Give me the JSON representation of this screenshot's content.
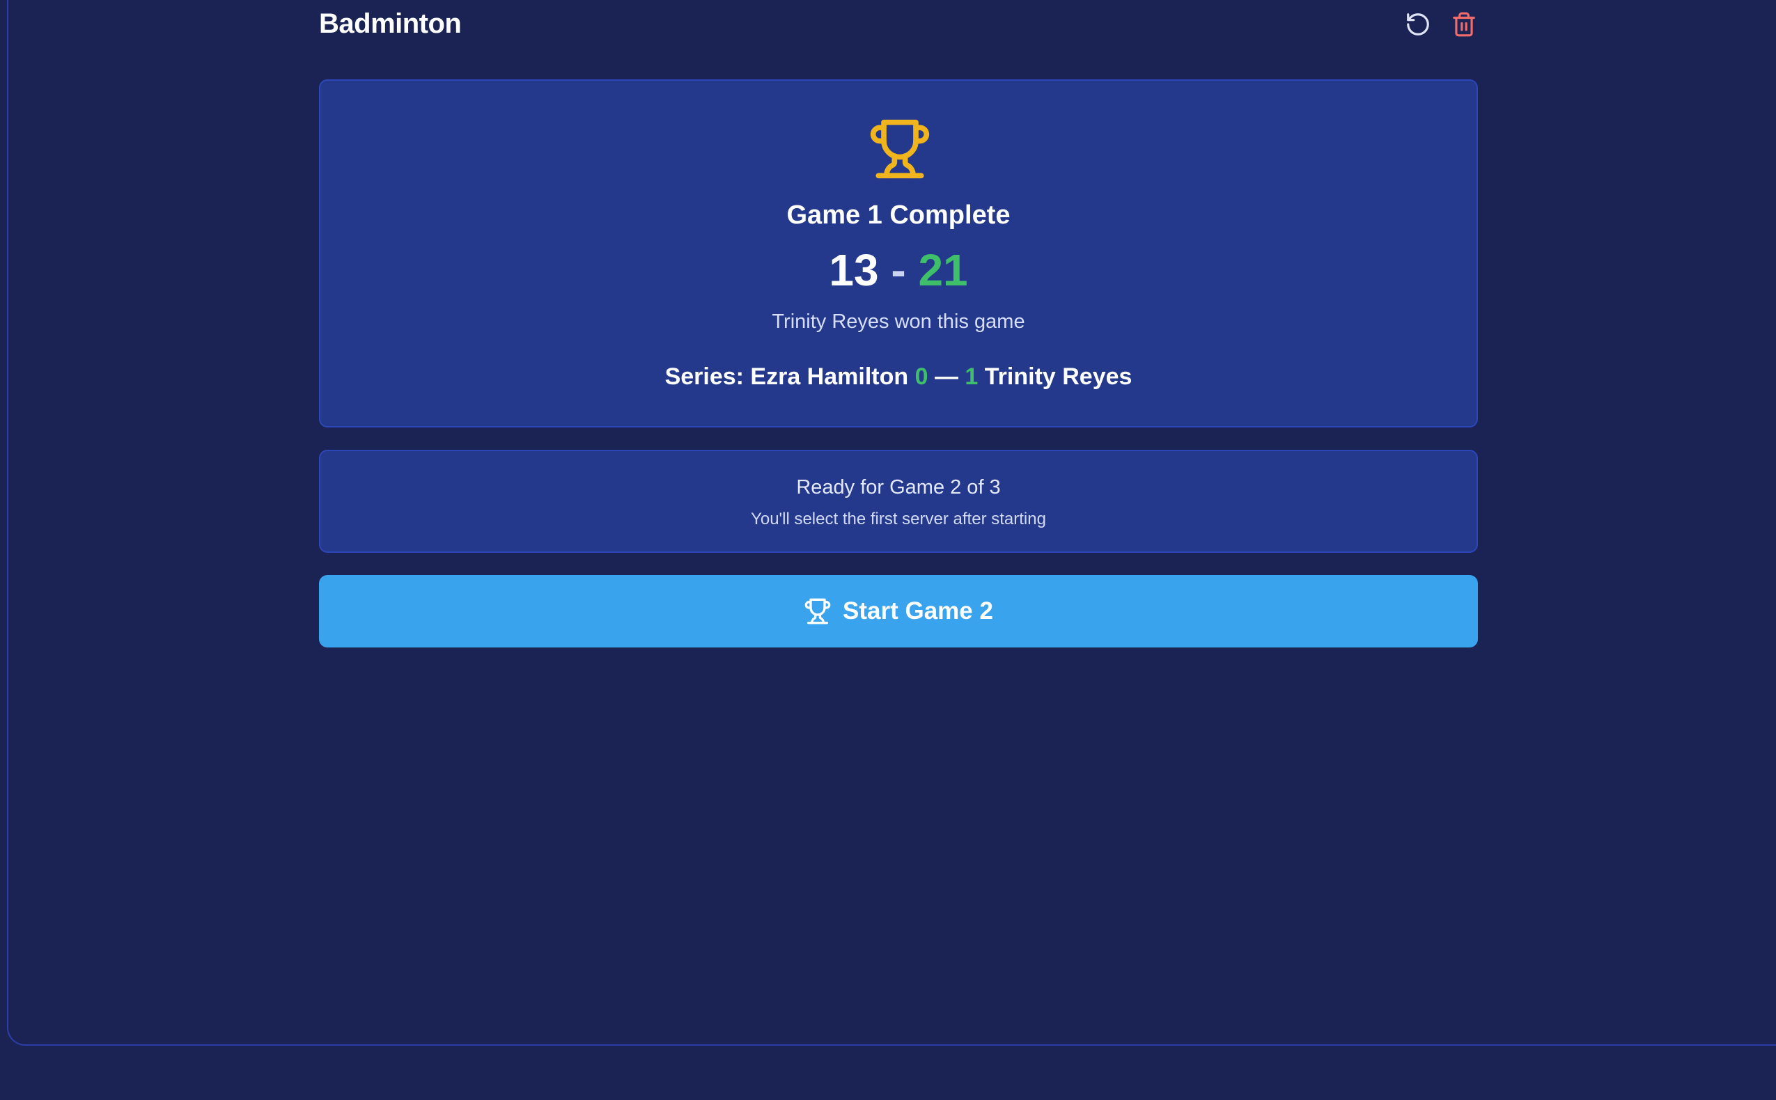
{
  "header": {
    "title": "Badminton",
    "reset_icon": "rotate-ccw-icon",
    "delete_icon": "trash-icon",
    "delete_color": "#f06b6b"
  },
  "result": {
    "icon": "trophy-icon",
    "icon_color": "#f0b41c",
    "title": "Game 1 Complete",
    "score_left": "13",
    "score_separator": "-",
    "score_right": "21",
    "winner_text": "Trinity Reyes won this game",
    "series_prefix": "Series: Ezra Hamilton",
    "series_left_wins": "0",
    "series_dash": "—",
    "series_right_wins": "1",
    "series_suffix": "Trinity Reyes"
  },
  "ready": {
    "title": "Ready for Game 2 of 3",
    "subtitle": "You'll select the first server after starting"
  },
  "start_button": {
    "icon": "trophy-icon",
    "label": "Start Game 2",
    "color": "#3aa3ee"
  },
  "colors": {
    "background": "#1a2353",
    "card": "#24398c",
    "accent_green": "#3fbf6a"
  }
}
